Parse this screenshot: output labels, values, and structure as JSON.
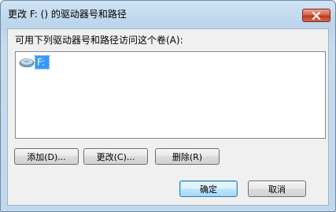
{
  "dialog": {
    "title": "更改 F: () 的驱动器号和路径"
  },
  "prompt": "可用下列驱动器号和路径访问这个卷(A):",
  "drives": [
    {
      "label": "F:",
      "icon": "drive-icon",
      "selected": true
    }
  ],
  "buttons": {
    "add": "添加(D)...",
    "change": "更改(C)...",
    "remove": "删除(R)",
    "ok": "确定",
    "cancel": "取消"
  },
  "colors": {
    "selection": "#3399ff",
    "close_button": "#c0391b",
    "window_frame": "#c2d8ed"
  }
}
